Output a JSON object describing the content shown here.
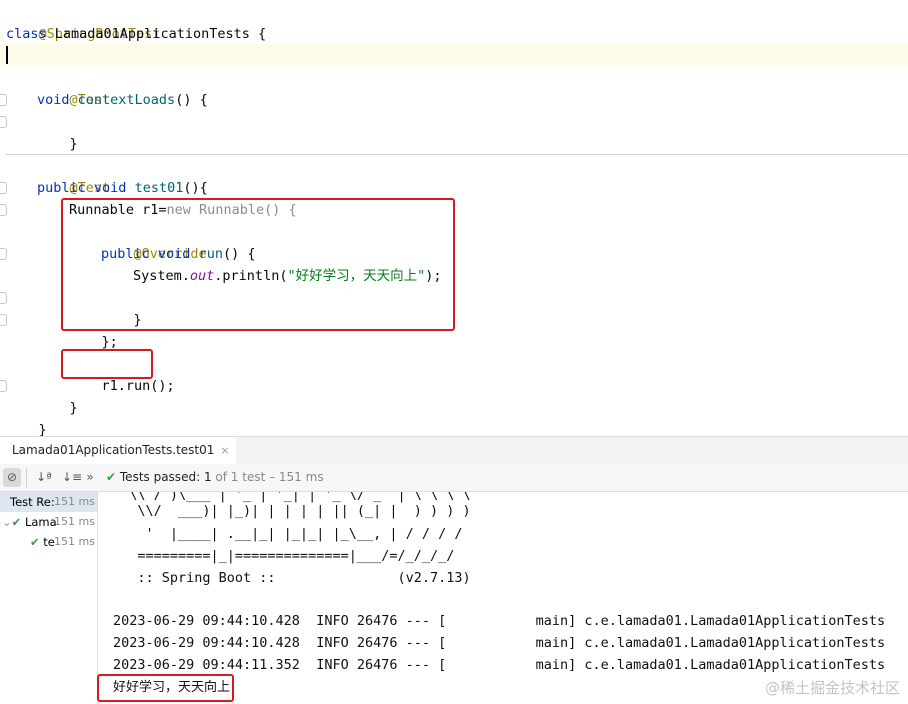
{
  "editor": {
    "annotation_sbt": "@SpringBootTest",
    "class_kw": "class",
    "class_name": "Lamada01ApplicationTests {",
    "test1_annotation": "@Test",
    "test1_void": "void",
    "test1_name": "contextLoads",
    "test1_rest": "() {",
    "test1_close": "}",
    "test2_annotation": "@Test",
    "test2_public": "public",
    "test2_void": "void",
    "test2_name": "test01",
    "test2_rest": "(){",
    "runnable_decl": "Runnable r1=",
    "new_kw": "new Runnable() {",
    "override": "@Override",
    "run_public": "public",
    "run_void": "void",
    "run_name": "run",
    "run_rest": "() {",
    "sys_out": "System.",
    "sys_field": "out",
    "sys_println": ".println(",
    "sys_string": "\"好好学习，天天向上\"",
    "sys_end": ");",
    "run_close": "}",
    "anon_close": "};",
    "r1_run": "r1.run();",
    "test2_close": "}",
    "class_close": "}"
  },
  "run_panel": {
    "tab_label": "Lamada01ApplicationTests.test01",
    "tab_close": "×",
    "tests_passed": "Tests passed:",
    "passed_count": "1",
    "of_total": "of 1 test – 151 ms",
    "tree": [
      {
        "label": "Test Re:",
        "time": "151 ms"
      },
      {
        "label": "Lama",
        "time": "151 ms"
      },
      {
        "label": "te",
        "time": "151 ms"
      }
    ]
  },
  "console": {
    "banner": [
      "  \\\\ / )\\___ | '_ | '_| | '_ \\/ _` | \\ \\ \\ \\",
      "   \\\\/  ___)| |_)| | | | | || (_| |  ) ) ) )",
      "    '  |____| .__|_| |_|_| |_\\__, | / / / /",
      "   =========|_|==============|___/=/_/_/_/",
      "   :: Spring Boot ::               (v2.7.13)"
    ],
    "logs": [
      "2023-06-29 09:44:10.428  INFO 26476 --- [           main] c.e.lamada01.Lamada01ApplicationTests",
      "2023-06-29 09:44:10.428  INFO 26476 --- [           main] c.e.lamada01.Lamada01ApplicationTests",
      "2023-06-29 09:44:11.352  INFO 26476 --- [           main] c.e.lamada01.Lamada01ApplicationTests"
    ],
    "output": "好好学习，天天向上"
  },
  "watermark": "@稀土掘金技术社区",
  "colors": {
    "highlight_box": "#d71920",
    "annotation": "#9e880d",
    "keyword": "#0033b3",
    "method": "#00627a",
    "string": "#067d17"
  }
}
